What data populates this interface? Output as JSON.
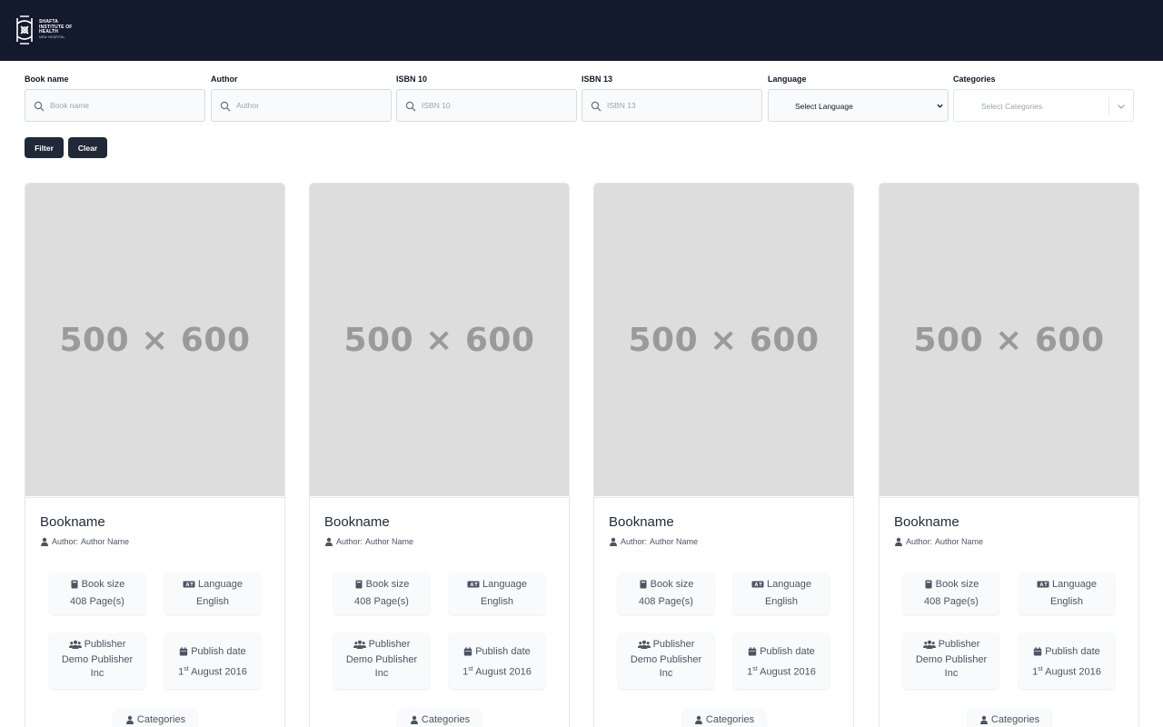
{
  "header": {
    "logo_lines": [
      "SHAFTA",
      "INSTITUTE OF",
      "HEALTH"
    ],
    "logo_sub": "NEW HOSPITAL"
  },
  "filters": {
    "book_name": {
      "label": "Book name",
      "placeholder": "Book name"
    },
    "author": {
      "label": "Author",
      "placeholder": "Author"
    },
    "isbn10": {
      "label": "ISBN 10",
      "placeholder": "ISBN 10"
    },
    "isbn13": {
      "label": "ISBN 13",
      "placeholder": "ISBN 13"
    },
    "language": {
      "label": "Language",
      "selected": "Select Language"
    },
    "categories": {
      "label": "Categories",
      "placeholder": "Select Categories"
    },
    "filter_button": "Filter",
    "clear_button": "Clear"
  },
  "colors": {
    "header_bg": "#141a2e",
    "button_bg": "#1f2937",
    "cover_bg": "#dddddd"
  },
  "cards": [
    {
      "cover_text": "500 × 600",
      "title": "Bookname",
      "author_label": "Author:",
      "author": "Author Name",
      "book_size_label": "Book size",
      "book_size": "408 Page(s)",
      "language_label": "Language",
      "language": "English",
      "publisher_label": "Publisher",
      "publisher": "Demo Publisher Inc",
      "publish_date_label": "Publish date",
      "publish_day": "1",
      "publish_suffix": "st",
      "publish_rest": " August 2016",
      "categories_label": "Categories"
    },
    {
      "cover_text": "500 × 600",
      "title": "Bookname",
      "author_label": "Author:",
      "author": "Author Name",
      "book_size_label": "Book size",
      "book_size": "408 Page(s)",
      "language_label": "Language",
      "language": "English",
      "publisher_label": "Publisher",
      "publisher": "Demo Publisher Inc",
      "publish_date_label": "Publish date",
      "publish_day": "1",
      "publish_suffix": "st",
      "publish_rest": " August 2016",
      "categories_label": "Categories"
    },
    {
      "cover_text": "500 × 600",
      "title": "Bookname",
      "author_label": "Author:",
      "author": "Author Name",
      "book_size_label": "Book size",
      "book_size": "408 Page(s)",
      "language_label": "Language",
      "language": "English",
      "publisher_label": "Publisher",
      "publisher": "Demo Publisher Inc",
      "publish_date_label": "Publish date",
      "publish_day": "1",
      "publish_suffix": "st",
      "publish_rest": " August 2016",
      "categories_label": "Categories"
    },
    {
      "cover_text": "500 × 600",
      "title": "Bookname",
      "author_label": "Author:",
      "author": "Author Name",
      "book_size_label": "Book size",
      "book_size": "408 Page(s)",
      "language_label": "Language",
      "language": "English",
      "publisher_label": "Publisher",
      "publisher": "Demo Publisher Inc",
      "publish_date_label": "Publish date",
      "publish_day": "1",
      "publish_suffix": "st",
      "publish_rest": " August 2016",
      "categories_label": "Categories"
    }
  ]
}
